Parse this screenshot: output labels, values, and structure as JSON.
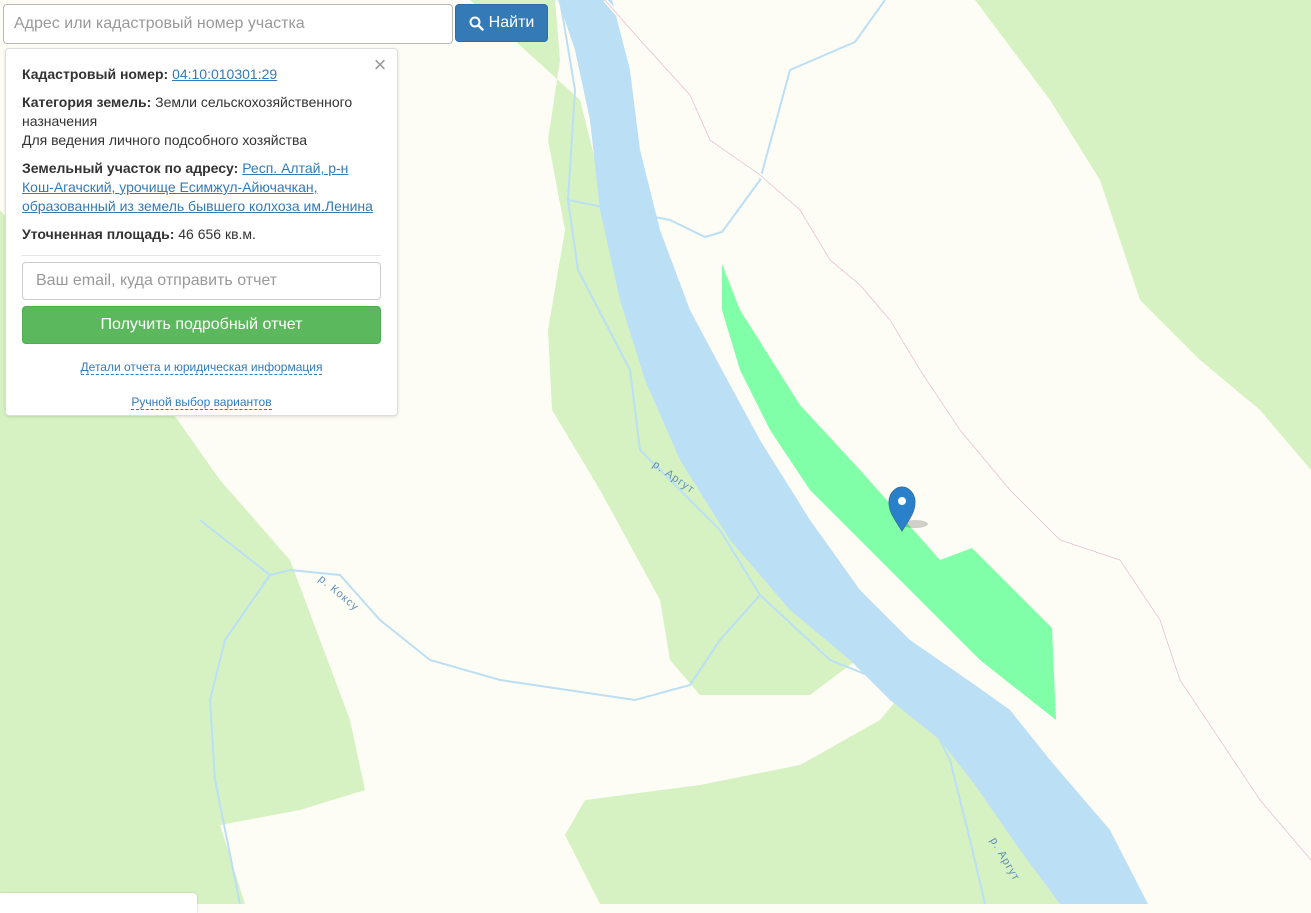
{
  "search": {
    "placeholder": "Адрес или кадастровый номер участка",
    "value": "",
    "button_label": "Найти"
  },
  "info_panel": {
    "cadastral_label": "Кадастровый номер:",
    "cadastral_number": "04:10:010301:29",
    "category_label": "Категория земель:",
    "category_value": "Земли сельскохозяйственного назначения",
    "permitted_use": "Для ведения личного подсобного хозяйства",
    "address_label": "Земельный участок по адресу:",
    "address_value": "Респ. Алтай, р-н Кош-Агачский, урочище Есимжул-Айючачкан, образованный из земель бывшего колхоза им.Ленина",
    "area_label": "Уточненная площадь:",
    "area_value": "46 656 кв.м.",
    "email_placeholder": "Ваш email, куда отправить отчет",
    "report_button": "Получить подробный отчет",
    "details_link": "Детали отчета и юридическая информация",
    "manual_link": "Ручной выбор вариантов"
  },
  "map": {
    "labels": {
      "argut_1": "р. Аргут",
      "argut_2": "р. Аргут",
      "koksu": "р. Коксу"
    },
    "colors": {
      "background": "#fefdf5",
      "forest": "#d6f2c2",
      "river": "#bbdff5",
      "parcel": "#80ffa8",
      "marker": "#2a81cb"
    }
  }
}
